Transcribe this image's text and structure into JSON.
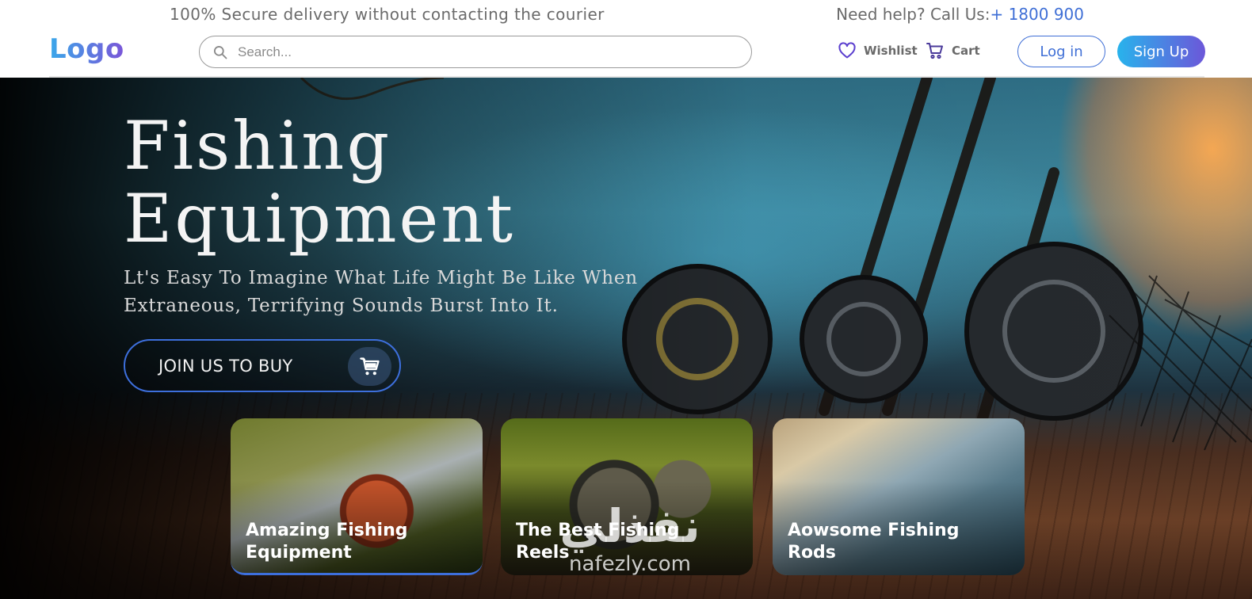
{
  "topbar": {
    "promo": "100% Secure delivery without contacting the courier",
    "help_label": "Need help? Call Us:",
    "help_phone": "+ 1800 900"
  },
  "header": {
    "logo": "Logo",
    "search_placeholder": "Search...",
    "search_icon": "search-icon",
    "wishlist_label": "Wishlist",
    "wishlist_icon": "heart-icon",
    "cart_label": "Cart",
    "cart_icon": "cart-icon",
    "login_label": "Log in",
    "signup_label": "Sign Up"
  },
  "hero": {
    "title_line1": "Fishing",
    "title_line2": "Equipment",
    "subtitle": "Lt's Easy To Imagine What Life Might Be Like When Extraneous, Terrifying Sounds Burst Into It.",
    "cta_label": "JOIN US TO BUY",
    "cta_icon": "cart-icon"
  },
  "cards": [
    {
      "title": "Amazing Fishing Equipment"
    },
    {
      "title": "The Best Fishing Reels"
    },
    {
      "title": "Aowsome Fishing Rods"
    }
  ],
  "watermark": {
    "arabic": "نفذلي",
    "latin": "nafezly.com"
  },
  "colors": {
    "accent_blue": "#3f6fd6",
    "signup_gradient_start": "#28b3ec",
    "signup_gradient_end": "#6c57d9"
  }
}
